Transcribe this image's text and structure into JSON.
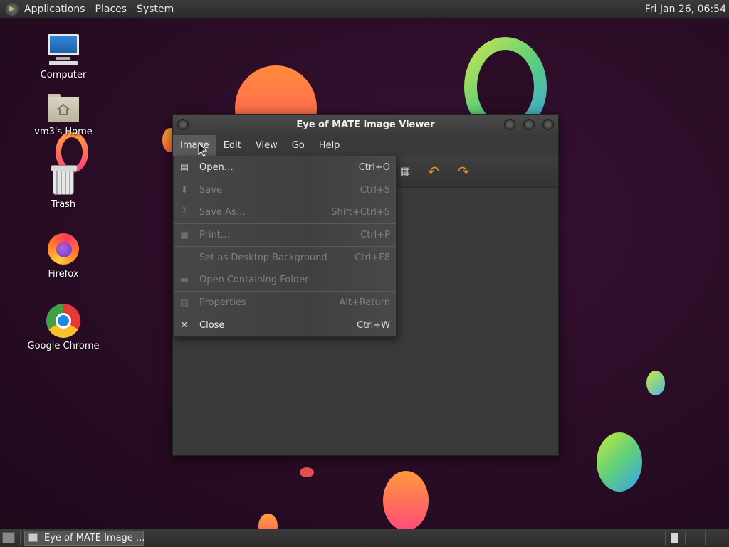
{
  "top_panel": {
    "menus": [
      "Applications",
      "Places",
      "System"
    ],
    "clock": "Fri Jan 26, 06:54"
  },
  "desktop": {
    "icons": [
      {
        "label": "Computer",
        "icon": "computer-icon"
      },
      {
        "label": "vm3's Home",
        "icon": "home-folder-icon"
      },
      {
        "label": "Trash",
        "icon": "trash-icon"
      },
      {
        "label": "Firefox",
        "icon": "firefox-icon"
      },
      {
        "label": "Google Chrome",
        "icon": "chrome-icon"
      }
    ]
  },
  "window": {
    "title": "Eye of MATE Image Viewer",
    "menubar": [
      "Image",
      "Edit",
      "View",
      "Go",
      "Help"
    ],
    "active_menu": "Image"
  },
  "image_menu": {
    "items": [
      {
        "label": "Open…",
        "accel": "Ctrl+O",
        "enabled": true,
        "icon": "folder-open-icon"
      },
      {
        "label": "Save",
        "accel": "Ctrl+S",
        "enabled": false,
        "icon": "save-icon"
      },
      {
        "label": "Save As…",
        "accel": "Shift+Ctrl+S",
        "enabled": false,
        "icon": "save-as-icon"
      },
      {
        "label": "Print…",
        "accel": "Ctrl+P",
        "enabled": false,
        "icon": "print-icon"
      },
      {
        "label": "Set as Desktop Background",
        "accel": "Ctrl+F8",
        "enabled": false,
        "icon": ""
      },
      {
        "label": "Open Containing Folder",
        "accel": "",
        "enabled": false,
        "icon": "folder-icon"
      },
      {
        "label": "Properties",
        "accel": "Alt+Return",
        "enabled": false,
        "icon": "properties-icon"
      },
      {
        "label": "Close",
        "accel": "Ctrl+W",
        "enabled": true,
        "icon": "close-icon"
      }
    ]
  },
  "taskbar": {
    "tasks": [
      {
        "label": "Eye of MATE Image ...",
        "icon": "image-viewer-icon"
      }
    ]
  }
}
